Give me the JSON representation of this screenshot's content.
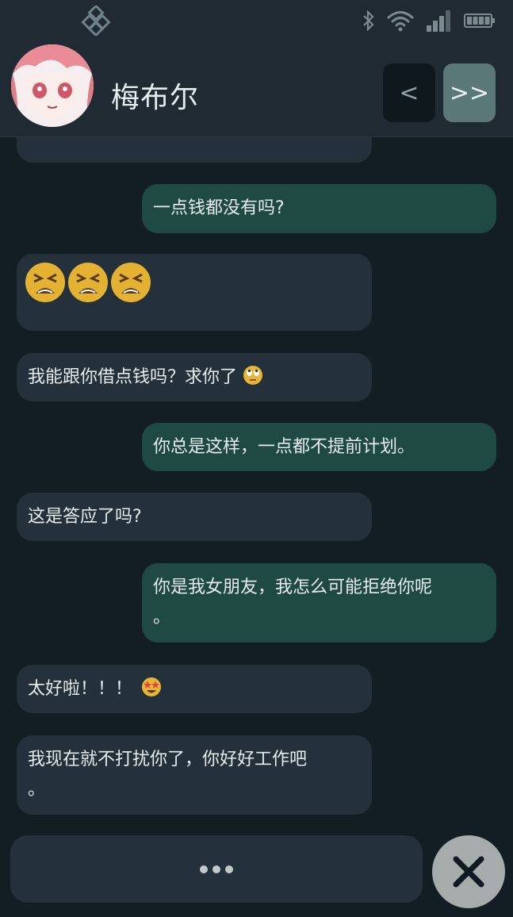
{
  "contact": {
    "name": "梅布尔"
  },
  "nav": {
    "prev_label": "<",
    "next_label": ">>"
  },
  "status": {
    "icons": [
      "bluetooth-icon",
      "wifi-icon",
      "signal-icon",
      "battery-icon"
    ]
  },
  "messages": [
    {
      "sender": "me",
      "text": "一点钱都没有吗?"
    },
    {
      "sender": "bot",
      "emoji": [
        "tired-face-icon",
        "tired-face-icon",
        "tired-face-icon"
      ]
    },
    {
      "sender": "bot",
      "text": "我能跟你借点钱吗？求你了"
    },
    {
      "sender": "me",
      "text": "你总是这样，一点都不提前计划。"
    },
    {
      "sender": "bot",
      "text": "这是答应了吗?"
    },
    {
      "sender": "me",
      "line1": "你是我女朋友，我怎么可能拒绝你呢",
      "line2": "。"
    },
    {
      "sender": "bot",
      "text": "太好啦！！！"
    },
    {
      "sender": "bot",
      "line1": "我现在就不打扰你了，你好好工作吧",
      "line2": "。"
    }
  ],
  "colors": {
    "bot_bubble": "#24303a",
    "user_bubble": "#1f4a44",
    "background": "#131d24",
    "header": "#1f2a33"
  }
}
